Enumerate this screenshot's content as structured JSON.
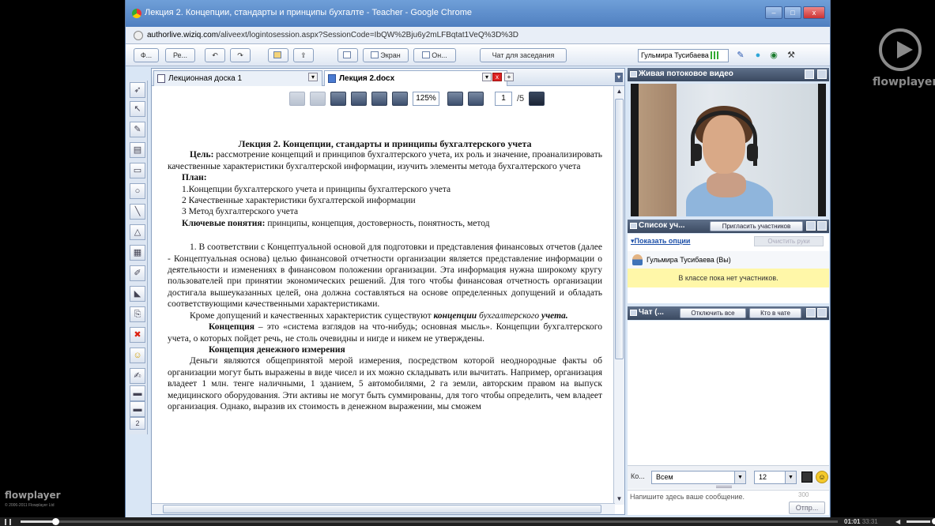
{
  "browser": {
    "title": "Лекция 2. Концепции, стандарты и принципы бухгалте - Teacher - Google Chrome",
    "url_host": "authorlive.wiziq.com",
    "url_path": "/aliveext/logintosession.aspx?SessionCode=IbQW%2Bju6y2mLFBqtat1VeQ%3D%3D",
    "window_buttons": [
      "–",
      "□",
      "x"
    ]
  },
  "toolbar": {
    "btn_1": "Ф...",
    "btn_2": "Ре...",
    "screen": "Экран",
    "on": "Он...",
    "chat_session": "Чат для заседания",
    "user": "Гульмира Тусибаева"
  },
  "tools": [
    "select-arrow",
    "pointer",
    "pencil",
    "text",
    "rectangle",
    "circle",
    "line",
    "triangle",
    "table",
    "highlighter",
    "eraser",
    "copy",
    "delete",
    "emoticon",
    "paint",
    "pen",
    "stroke",
    "page-number"
  ],
  "tool_page_number": "2",
  "doc_tabs": {
    "tab1": "Лекционная доска 1",
    "tab2": "Лекция 2.docx"
  },
  "doc_toolbar": {
    "zoom": "125%",
    "page": "1",
    "total": "/5"
  },
  "document": {
    "title": "Лекция 2. Концепции, стандарты и принципы бухгалтерского учета",
    "goal_label": "Цель:",
    "goal_text": " рассмотрение концепций и принципов   бухгалтерского учета, их роль и значение, проанализировать качественные характеристики бухгалтерской информации, изучить элементы метода бухгалтерского учета",
    "plan_label": "План:",
    "plan_1": "1.Концепции бухгалтерского учета и принципы бухгалтерского учета",
    "plan_2": "2 Качественные характеристики бухгалтерской информации",
    "plan_3": "3 Метод бухгалтерского учета",
    "key_label": "Ключевые понятия:",
    "key_text": "  принципы, концепция, достоверность, понятность, метод",
    "para_1": "1. В соответствии с Концептуальной основой для подготовки и представления финансовых отчетов (далее - Концептуальная основа) целью финансовой отчетности организации является представление информации о деятельности и изменениях в финансовом положении организации. Эта информация нужна широкому кругу пользователей при принятии экономических решений. Для того чтобы финансовая отчетность организации достигала вышеуказанных целей, она должна составляться на основе определенных допущений и обладать соответствующими качественными характеристиками.",
    "para_2a": "Кроме допущений и качественных характеристик существуют ",
    "para_2b": "концепции",
    "para_2c": " бухгалтерского ",
    "para_2d": "учета.",
    "para_3a": "Концепция",
    "para_3b": " – это «система взглядов на что-нибудь; основная мысль». Концепции бухгалтерского учета, о которых пойдет речь, не столь очевидны и нигде и никем не утверждены.",
    "heading_money": "Концепция денежного измерения",
    "para_4": "Деньги являются общепринятой мерой измерения, посредством которой неоднородные факты об организации могут быть выражены в виде чисел и их можно складывать или вычитать. Например, организация владеет 1 млн. тенге наличными, 1 зданием, 5 автомобилями, 2 га земли, авторским правом на выпуск медицинского оборудования. Эти активы не могут быть суммированы, для того чтобы определить, чем владеет организация. Однако, выразив их стоимость в денежном выражении, мы сможем"
  },
  "video_panel": {
    "title": "Живая потоковое видео"
  },
  "attendees": {
    "title": "Список уч...",
    "invite": "Пригласить участников",
    "show_options": "Показать опции",
    "clear_hands": "Очистить руки",
    "user": "Гульмира Тусибаева (Вы)",
    "empty": "В классе пока нет участников."
  },
  "chat": {
    "title": "Чат (...",
    "mute_all": "Отключить все",
    "in_chat": "Кто в чате",
    "to_label": "Ко...",
    "to_value": "Всем",
    "font_size": "12",
    "placeholder": "Напишите здесь ваше сообщение.",
    "char_count": "300",
    "send": "Отпр..."
  },
  "player": {
    "brand": "flowplayer",
    "copyright": "© 2006-2011 Flowplayer Ltd",
    "time_current": "01:01",
    "time_total": "33:31"
  },
  "colors": {
    "panel_header": "#3a4960",
    "notice": "#fff7a8",
    "window_title": "#4f7fc0"
  }
}
